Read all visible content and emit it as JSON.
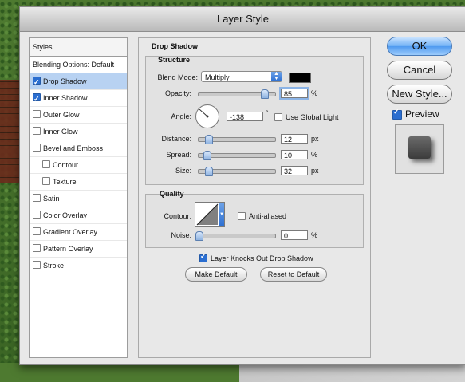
{
  "window": {
    "title": "Layer Style"
  },
  "sidebar": {
    "header": "Styles",
    "blending": "Blending Options: Default",
    "items": [
      {
        "label": "Drop Shadow",
        "checked": true,
        "selected": true,
        "indent": false
      },
      {
        "label": "Inner Shadow",
        "checked": true,
        "selected": false,
        "indent": false
      },
      {
        "label": "Outer Glow",
        "checked": false,
        "selected": false,
        "indent": false
      },
      {
        "label": "Inner Glow",
        "checked": false,
        "selected": false,
        "indent": false
      },
      {
        "label": "Bevel and Emboss",
        "checked": false,
        "selected": false,
        "indent": false
      },
      {
        "label": "Contour",
        "checked": false,
        "selected": false,
        "indent": true
      },
      {
        "label": "Texture",
        "checked": false,
        "selected": false,
        "indent": true
      },
      {
        "label": "Satin",
        "checked": false,
        "selected": false,
        "indent": false
      },
      {
        "label": "Color Overlay",
        "checked": false,
        "selected": false,
        "indent": false
      },
      {
        "label": "Gradient Overlay",
        "checked": false,
        "selected": false,
        "indent": false
      },
      {
        "label": "Pattern Overlay",
        "checked": false,
        "selected": false,
        "indent": false
      },
      {
        "label": "Stroke",
        "checked": false,
        "selected": false,
        "indent": false
      }
    ]
  },
  "panel": {
    "section_title": "Drop Shadow",
    "structure": {
      "title": "Structure",
      "blend_mode_label": "Blend Mode:",
      "blend_mode_value": "Multiply",
      "shadow_color": "#000000",
      "opacity_label": "Opacity:",
      "opacity_value": "85",
      "opacity_unit": "%",
      "opacity_fraction": 0.85,
      "angle_label": "Angle:",
      "angle_value": "-138",
      "angle_unit": "°",
      "use_global_light_label": "Use Global Light",
      "use_global_light_checked": false,
      "distance_label": "Distance:",
      "distance_value": "12",
      "distance_unit": "px",
      "spread_label": "Spread:",
      "spread_value": "10",
      "spread_unit": "%",
      "size_label": "Size:",
      "size_value": "32",
      "size_unit": "px"
    },
    "quality": {
      "title": "Quality",
      "contour_label": "Contour:",
      "anti_aliased_label": "Anti-aliased",
      "anti_aliased_checked": false,
      "noise_label": "Noise:",
      "noise_value": "0",
      "noise_unit": "%"
    },
    "knockout_label": "Layer Knocks Out Drop Shadow",
    "knockout_checked": true,
    "make_default_label": "Make Default",
    "reset_default_label": "Reset to Default"
  },
  "actions": {
    "ok_label": "OK",
    "cancel_label": "Cancel",
    "new_style_label": "New Style...",
    "preview_label": "Preview",
    "preview_checked": true
  },
  "colors": {
    "accent": "#2b6ed0",
    "selection": "#b8d2f2"
  }
}
